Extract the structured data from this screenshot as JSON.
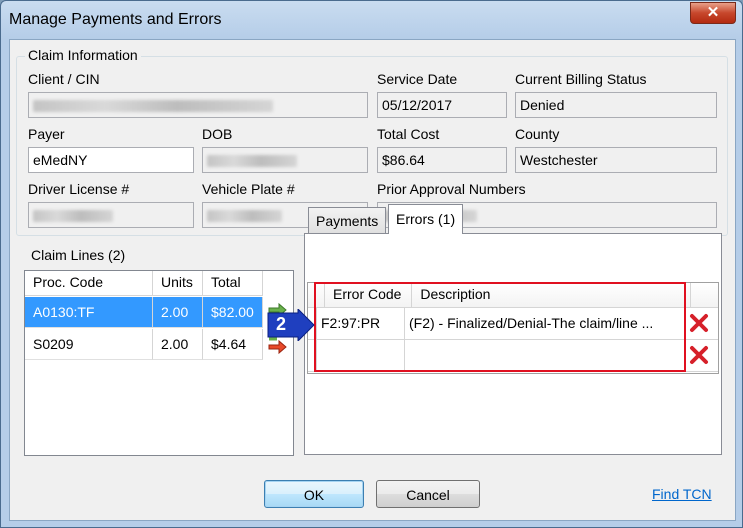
{
  "window": {
    "title": "Manage Payments and Errors",
    "close_label": "✕"
  },
  "claim_info": {
    "group_title": "Claim Information",
    "client_cin_label": "Client / CIN",
    "service_date_label": "Service Date",
    "service_date": "05/12/2017",
    "billing_status_label": "Current Billing Status",
    "billing_status": "Denied",
    "payer_label": "Payer",
    "payer": "eMedNY",
    "dob_label": "DOB",
    "total_cost_label": "Total Cost",
    "total_cost": "$86.64",
    "county_label": "County",
    "county": "Westchester",
    "driver_license_label": "Driver License #",
    "vehicle_plate_label": "Vehicle Plate #",
    "prior_approval_label": "Prior Approval Numbers"
  },
  "claim_lines": {
    "group_title": "Claim Lines (2)",
    "columns": [
      "Proc. Code",
      "Units",
      "Total"
    ],
    "rows": [
      {
        "proc_code": "A0130:TF",
        "units": "2.00",
        "total": "$82.00",
        "selected": true
      },
      {
        "proc_code": "S0209",
        "units": "2.00",
        "total": "$4.64",
        "selected": false
      }
    ]
  },
  "tabs": [
    {
      "label": "Payments",
      "active": false
    },
    {
      "label": "Errors (1)",
      "active": true
    }
  ],
  "errors_grid": {
    "columns": [
      "Error Code",
      "Description"
    ],
    "rows": [
      {
        "code": "F2:97:PR",
        "description": "(F2) - Finalized/Denial-The claim/line ..."
      },
      {
        "code": "",
        "description": ""
      }
    ]
  },
  "callout_marker": "2",
  "buttons": {
    "ok": "OK",
    "cancel": "Cancel"
  },
  "find_tcn_link": "Find TCN",
  "colors": {
    "selection": "#3399ff",
    "delete_red": "#d6202a",
    "highlight_box": "#e01020",
    "marker_blue": "#1f3fbf"
  }
}
